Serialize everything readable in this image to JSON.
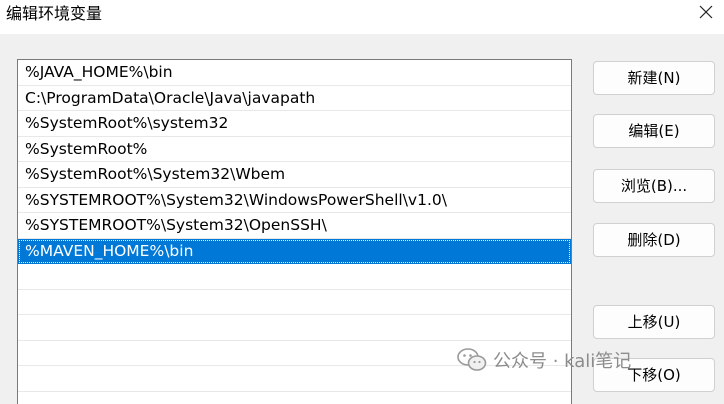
{
  "window": {
    "title": "编辑环境变量",
    "close_icon": "close-icon"
  },
  "list": {
    "items": [
      {
        "label": "%JAVA_HOME%\\bin",
        "selected": false
      },
      {
        "label": "C:\\ProgramData\\Oracle\\Java\\javapath",
        "selected": false
      },
      {
        "label": "%SystemRoot%\\system32",
        "selected": false
      },
      {
        "label": "%SystemRoot%",
        "selected": false
      },
      {
        "label": "%SystemRoot%\\System32\\Wbem",
        "selected": false
      },
      {
        "label": "%SYSTEMROOT%\\System32\\WindowsPowerShell\\v1.0\\",
        "selected": false
      },
      {
        "label": "%SYSTEMROOT%\\System32\\OpenSSH\\",
        "selected": false
      },
      {
        "label": "%MAVEN_HOME%\\bin",
        "selected": true
      }
    ],
    "selected_color": "#0078d7"
  },
  "buttons": {
    "new": "新建(N)",
    "edit": "编辑(E)",
    "browse": "浏览(B)...",
    "delete": "删除(D)",
    "move_up": "上移(U)",
    "move_down": "下移(O)"
  },
  "watermark": {
    "text": "公众号 · kali笔记",
    "icon": "wechat-icon"
  }
}
